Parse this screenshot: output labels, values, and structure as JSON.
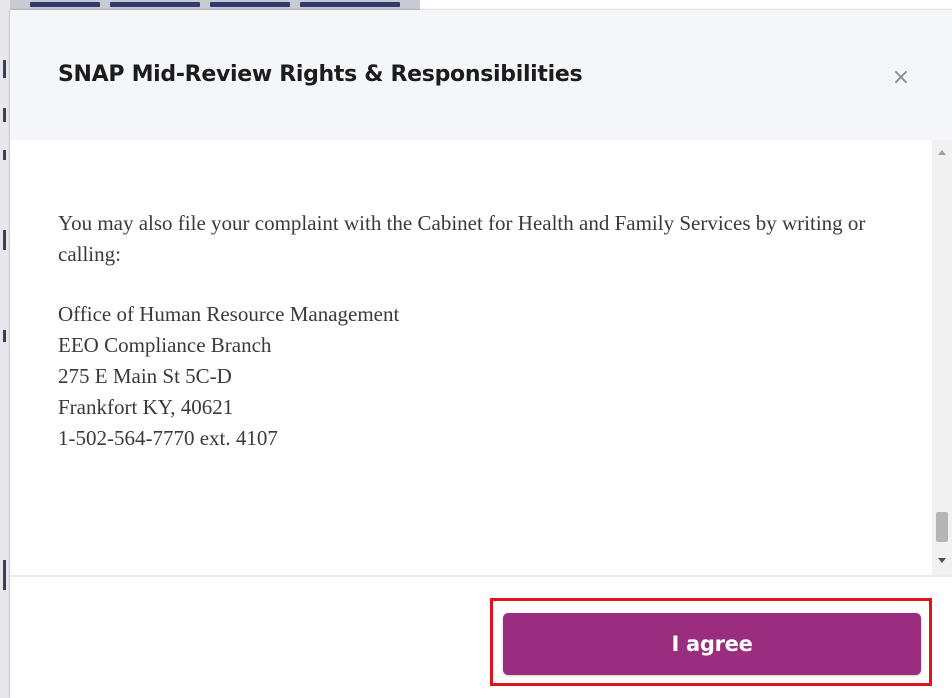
{
  "modal": {
    "title": "SNAP Mid-Review Rights & Responsibilities",
    "close_label": "×",
    "body": {
      "paragraph": "You may also file your complaint with the Cabinet for Health and Family Services by writing or calling:",
      "address_lines": [
        "Office of Human Resource Management",
        "EEO Compliance Branch",
        "275 E Main St 5C-D",
        "Frankfort KY, 40621",
        "1-502-564-7770 ext. 4107"
      ]
    },
    "footer": {
      "agree_label": "I agree"
    }
  },
  "colors": {
    "accent_button": "#9a2d7e",
    "highlight_frame": "#e0131b",
    "header_background": "#f5f6f9",
    "body_text": "#3a3a3a"
  },
  "icons": {
    "close": "close-icon",
    "scroll_up": "chevron-up-icon",
    "scroll_down": "chevron-down-icon"
  }
}
